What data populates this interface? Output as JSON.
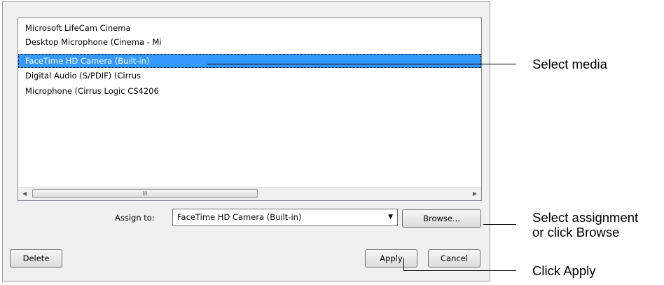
{
  "media_list": {
    "items": [
      "Microsoft LifeCam Cinema",
      "Desktop Microphone (Cinema - Mi",
      "FaceTime HD Camera (Built-in)",
      "Digital Audio (S/PDIF) (Cirrus",
      "Microphone (Cirrus Logic CS4206"
    ],
    "selected_index": 2,
    "scrollbar": {
      "left_arrow_icon": "◀",
      "right_arrow_icon": "▶",
      "thumb_grip": "III"
    }
  },
  "assign": {
    "label": "Assign to:",
    "selected_value": "FaceTime HD Camera (Built-in)",
    "dropdown_icon": "▼",
    "browse_label": "Browse..."
  },
  "buttons": {
    "delete": "Delete",
    "apply": "Apply",
    "cancel": "Cancel"
  },
  "callouts": {
    "select_media": "Select media",
    "select_assignment_line1": "Select assignment",
    "select_assignment_line2": "or click Browse",
    "click_apply": "Click Apply"
  }
}
